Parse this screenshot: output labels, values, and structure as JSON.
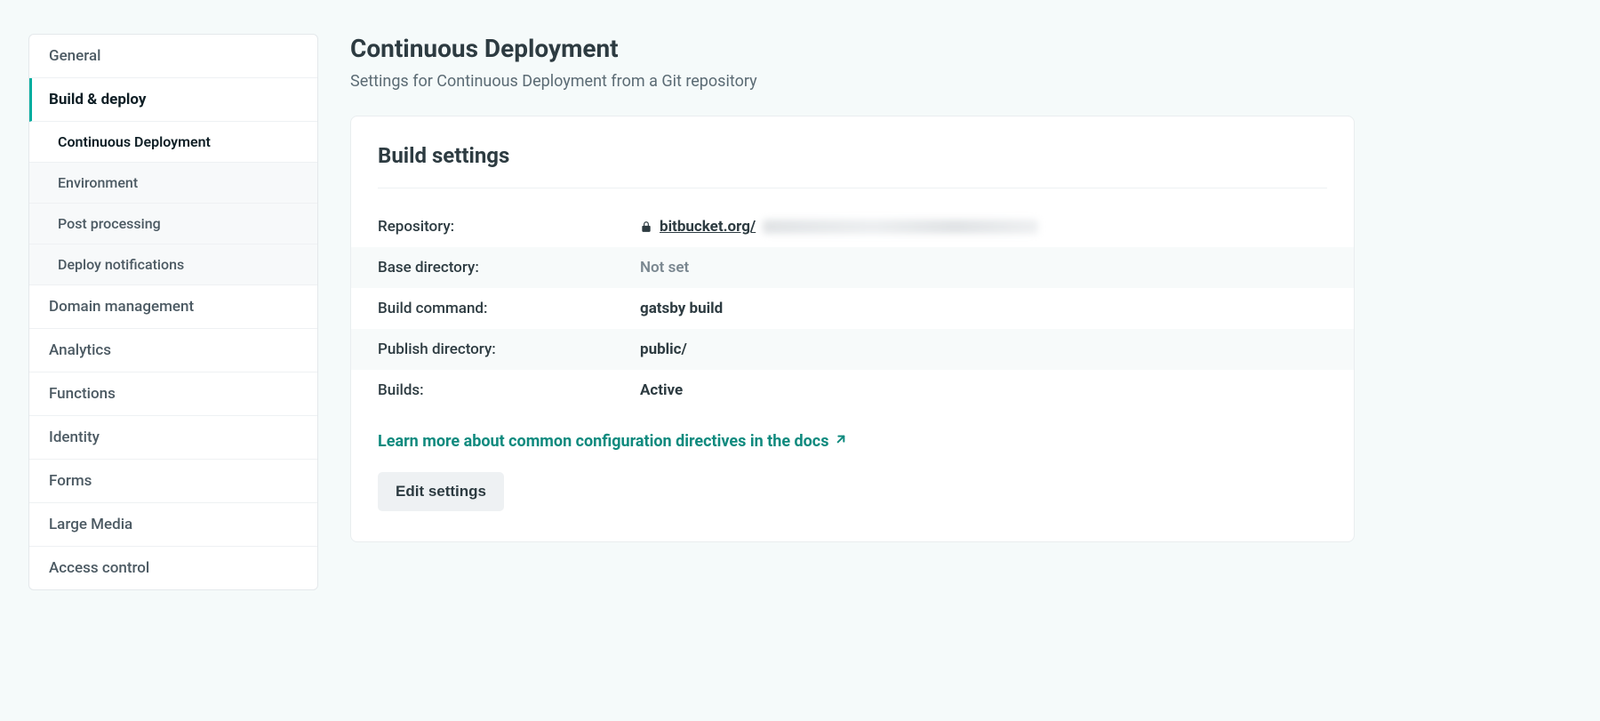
{
  "sidebar": {
    "items": [
      {
        "label": "General"
      },
      {
        "label": "Build & deploy",
        "active": true
      },
      {
        "label": "Domain management"
      },
      {
        "label": "Analytics"
      },
      {
        "label": "Functions"
      },
      {
        "label": "Identity"
      },
      {
        "label": "Forms"
      },
      {
        "label": "Large Media"
      },
      {
        "label": "Access control"
      }
    ],
    "sub": [
      {
        "label": "Continuous Deployment",
        "active": true
      },
      {
        "label": "Environment"
      },
      {
        "label": "Post processing"
      },
      {
        "label": "Deploy notifications"
      }
    ]
  },
  "header": {
    "title": "Continuous Deployment",
    "subtitle": "Settings for Continuous Deployment from a Git repository"
  },
  "card": {
    "title": "Build settings",
    "rows": {
      "repository_label": "Repository:",
      "repository_value": "bitbucket.org/",
      "base_dir_label": "Base directory:",
      "base_dir_value": "Not set",
      "build_cmd_label": "Build command:",
      "build_cmd_value": "gatsby build",
      "publish_dir_label": "Publish directory:",
      "publish_dir_value": "public/",
      "builds_label": "Builds:",
      "builds_value": "Active"
    },
    "docs_link": "Learn more about common configuration directives in the docs",
    "edit_button": "Edit settings"
  }
}
